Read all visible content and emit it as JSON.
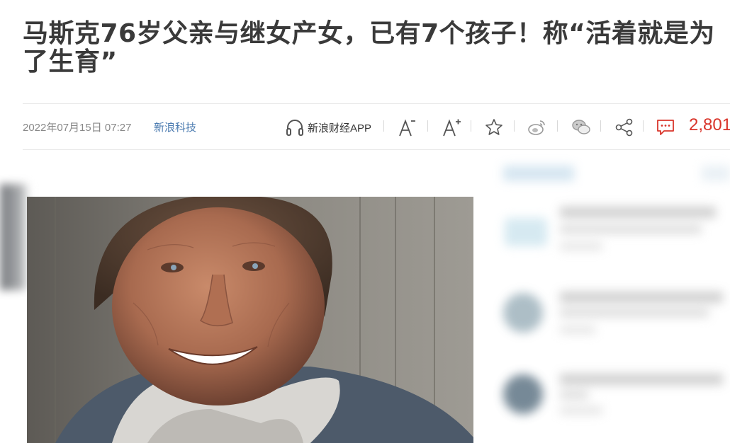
{
  "article": {
    "title": "马斯克76岁父亲与继女产女，已有7个孩子！称“活着就是为了生育”",
    "date": "2022年07月15日 07:27",
    "source": "新浪科技"
  },
  "toolbar": {
    "app_label": "新浪财经APP",
    "comment_count": "2,801",
    "icons": [
      "headphones-icon",
      "font-decrease-icon",
      "font-increase-icon",
      "star-icon",
      "weibo-icon",
      "wechat-icon",
      "share-icon",
      "comment-icon"
    ],
    "accent_color": "#d9352b"
  }
}
